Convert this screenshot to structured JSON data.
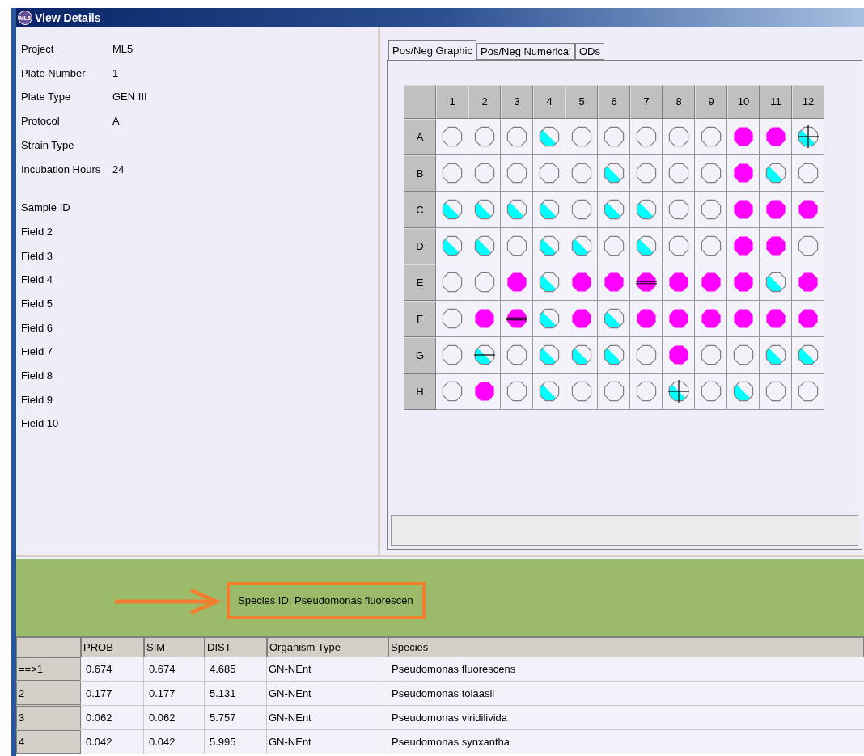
{
  "window": {
    "title": "View Details",
    "logo": "ML5"
  },
  "details": [
    {
      "label": "Project",
      "value": "ML5"
    },
    {
      "label": "Plate Number",
      "value": "1"
    },
    {
      "label": "Plate Type",
      "value": "GEN III"
    },
    {
      "label": "Protocol",
      "value": "A"
    },
    {
      "label": "Strain Type"
    },
    {
      "label": "Incubation Hours",
      "value": "24"
    }
  ],
  "fields": [
    "Sample ID",
    "Field 2",
    "Field 3",
    "Field 4",
    "Field 5",
    "Field 6",
    "Field 7",
    "Field 8",
    "Field 9",
    "Field 10"
  ],
  "tabs": [
    {
      "label": "Pos/Neg Graphic",
      "selected": true
    },
    {
      "label": "Pos/Neg Numerical",
      "selected": false
    },
    {
      "label": "ODs",
      "selected": false
    }
  ],
  "plate": {
    "columns": [
      "1",
      "2",
      "3",
      "4",
      "5",
      "6",
      "7",
      "8",
      "9",
      "10",
      "11",
      "12"
    ],
    "rows": [
      {
        "label": "A",
        "wells": [
          {
            "kind": "neg"
          },
          {
            "kind": "neg"
          },
          {
            "kind": "neg"
          },
          {
            "kind": "weak"
          },
          {
            "kind": "neg"
          },
          {
            "kind": "neg"
          },
          {
            "kind": "neg"
          },
          {
            "kind": "neg"
          },
          {
            "kind": "neg"
          },
          {
            "kind": "pos"
          },
          {
            "kind": "pos"
          },
          {
            "kind": "flagged"
          }
        ]
      },
      {
        "label": "B",
        "wells": [
          {
            "kind": "neg"
          },
          {
            "kind": "neg"
          },
          {
            "kind": "neg"
          },
          {
            "kind": "neg"
          },
          {
            "kind": "neg"
          },
          {
            "kind": "weak"
          },
          {
            "kind": "neg"
          },
          {
            "kind": "neg"
          },
          {
            "kind": "neg"
          },
          {
            "kind": "pos"
          },
          {
            "kind": "weak"
          },
          {
            "kind": "neg"
          }
        ]
      },
      {
        "label": "C",
        "wells": [
          {
            "kind": "weak"
          },
          {
            "kind": "weak"
          },
          {
            "kind": "weak"
          },
          {
            "kind": "weak"
          },
          {
            "kind": "neg"
          },
          {
            "kind": "weak"
          },
          {
            "kind": "weak"
          },
          {
            "kind": "neg"
          },
          {
            "kind": "neg"
          },
          {
            "kind": "pos"
          },
          {
            "kind": "pos"
          },
          {
            "kind": "pos"
          }
        ]
      },
      {
        "label": "D",
        "wells": [
          {
            "kind": "weak"
          },
          {
            "kind": "weak"
          },
          {
            "kind": "neg"
          },
          {
            "kind": "weak"
          },
          {
            "kind": "weak"
          },
          {
            "kind": "neg"
          },
          {
            "kind": "weak"
          },
          {
            "kind": "neg"
          },
          {
            "kind": "neg"
          },
          {
            "kind": "pos"
          },
          {
            "kind": "pos"
          },
          {
            "kind": "neg"
          }
        ]
      },
      {
        "label": "E",
        "wells": [
          {
            "kind": "neg"
          },
          {
            "kind": "neg"
          },
          {
            "kind": "pos"
          },
          {
            "kind": "weak"
          },
          {
            "kind": "pos"
          },
          {
            "kind": "pos"
          },
          {
            "kind": "posborder"
          },
          {
            "kind": "pos"
          },
          {
            "kind": "pos"
          },
          {
            "kind": "pos"
          },
          {
            "kind": "weak"
          },
          {
            "kind": "pos"
          }
        ]
      },
      {
        "label": "F",
        "wells": [
          {
            "kind": "neg"
          },
          {
            "kind": "pos"
          },
          {
            "kind": "posborder"
          },
          {
            "kind": "weak"
          },
          {
            "kind": "pos"
          },
          {
            "kind": "weak"
          },
          {
            "kind": "pos"
          },
          {
            "kind": "pos"
          },
          {
            "kind": "pos"
          },
          {
            "kind": "pos"
          },
          {
            "kind": "pos"
          },
          {
            "kind": "pos"
          }
        ]
      },
      {
        "label": "G",
        "wells": [
          {
            "kind": "neg"
          },
          {
            "kind": "weakborder"
          },
          {
            "kind": "neg"
          },
          {
            "kind": "weak"
          },
          {
            "kind": "weak"
          },
          {
            "kind": "weak"
          },
          {
            "kind": "neg"
          },
          {
            "kind": "pos"
          },
          {
            "kind": "neg"
          },
          {
            "kind": "neg"
          },
          {
            "kind": "weak"
          },
          {
            "kind": "weak"
          }
        ]
      },
      {
        "label": "H",
        "wells": [
          {
            "kind": "neg"
          },
          {
            "kind": "pos"
          },
          {
            "kind": "neg"
          },
          {
            "kind": "weak"
          },
          {
            "kind": "neg"
          },
          {
            "kind": "neg"
          },
          {
            "kind": "neg"
          },
          {
            "kind": "flagged"
          },
          {
            "kind": "neg"
          },
          {
            "kind": "weak"
          },
          {
            "kind": "neg"
          },
          {
            "kind": "neg"
          }
        ]
      }
    ]
  },
  "species_id": "Species ID: Pseudomonas fluorescen",
  "results": {
    "columns": [
      "PROB",
      "SIM",
      "DIST",
      "Organism Type",
      "Species"
    ],
    "rows": [
      {
        "rank": "==>1",
        "cells": [
          "0.674",
          "0.674",
          "4.685",
          "GN-NEnt",
          "Pseudomonas fluorescens"
        ]
      },
      {
        "rank": "2",
        "cells": [
          "0.177",
          "0.177",
          "5.131",
          "GN-NEnt",
          "Pseudomonas tolaasii"
        ]
      },
      {
        "rank": "3",
        "cells": [
          "0.062",
          "0.062",
          "5.757",
          "GN-NEnt",
          "Pseudomonas viridilivida"
        ]
      },
      {
        "rank": "4",
        "cells": [
          "0.042",
          "0.042",
          "5.995",
          "GN-NEnt",
          "Pseudomonas synxantha"
        ]
      }
    ]
  }
}
